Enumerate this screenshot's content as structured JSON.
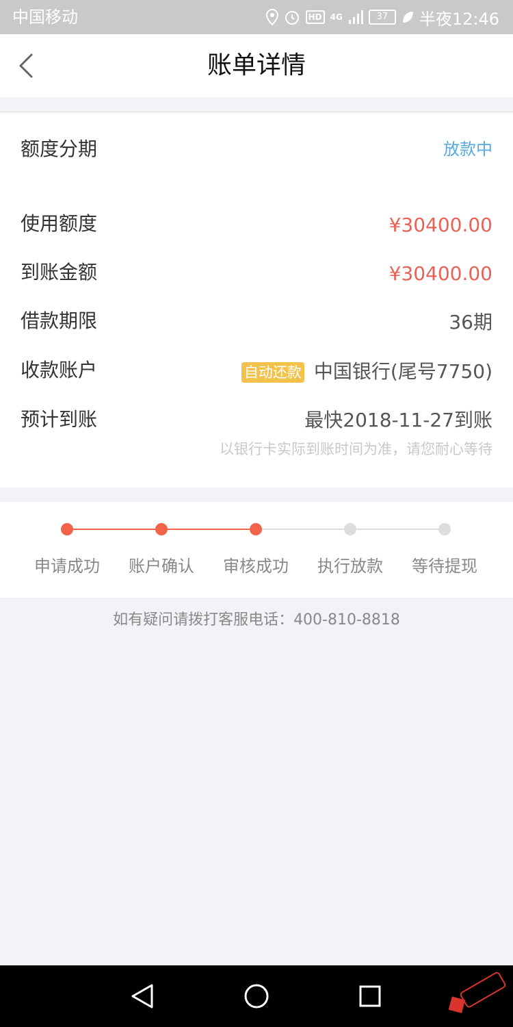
{
  "status_bar": {
    "carrier": "中国移动",
    "network": "4G",
    "hd_badge": "HD",
    "battery": "37",
    "time": "半夜12:46"
  },
  "header": {
    "title": "账单详情",
    "back_icon": "chevron-left-icon"
  },
  "bill_type": {
    "label": "额度分期",
    "status": "放款中",
    "status_color": "#58a9e0"
  },
  "details": {
    "used_label": "使用额度",
    "used_value": "¥30400.00",
    "received_label": "到账金额",
    "received_value": "¥30400.00",
    "term_label": "借款期限",
    "term_value": "36期",
    "account_label": "收款账户",
    "auto_badge": "自动还款",
    "account_value": "中国银行(尾号7750)",
    "eta_label": "预计到账",
    "eta_value": "最快2018-11-27到账",
    "eta_hint": "以银行卡实际到账时间为准，请您耐心等待",
    "amount_color": "#e96258"
  },
  "progress": {
    "steps": [
      {
        "label": "申请成功",
        "done": true
      },
      {
        "label": "账户确认",
        "done": true
      },
      {
        "label": "审核成功",
        "done": true
      },
      {
        "label": "执行放款",
        "done": false
      },
      {
        "label": "等待提现",
        "done": false
      }
    ],
    "active_color": "#f2634a",
    "inactive_color": "#dddddd"
  },
  "footer": {
    "contact": "如有疑问请拨打客服电话：400-810-8818"
  },
  "navbar": {
    "back": "triangle-back-icon",
    "home": "circle-home-icon",
    "recent": "square-recent-icon"
  }
}
